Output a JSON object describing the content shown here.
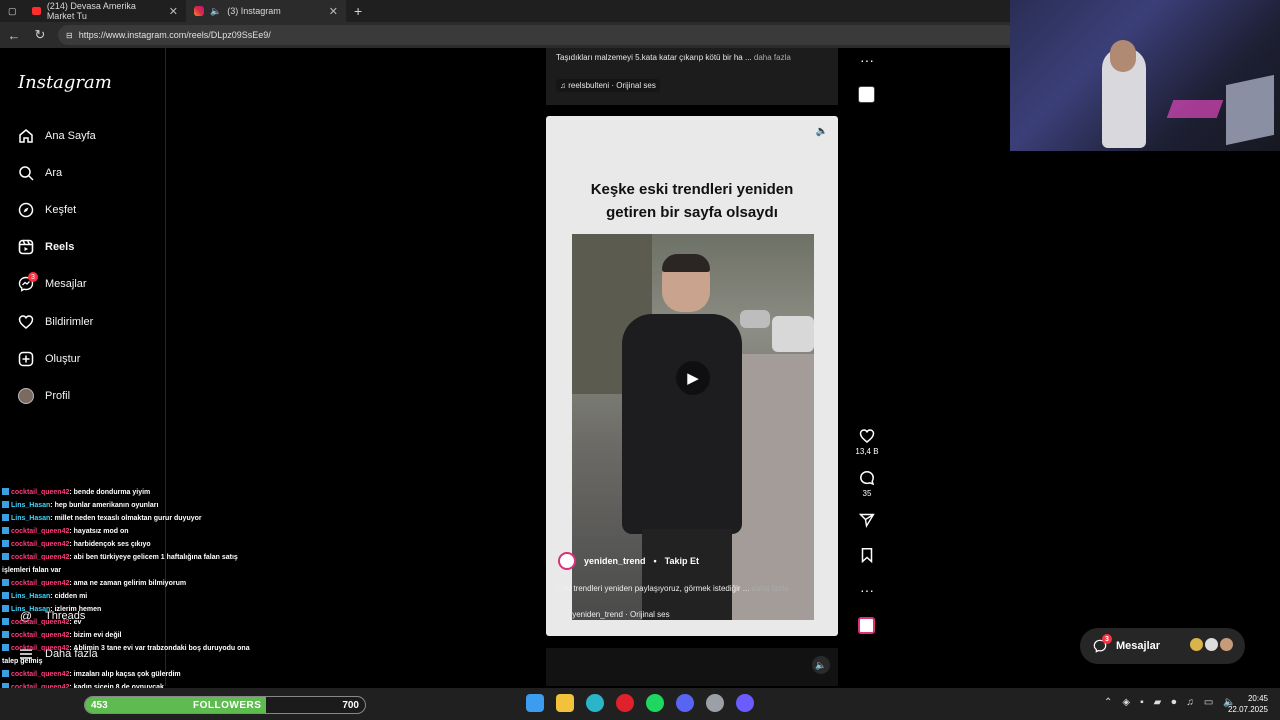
{
  "browser": {
    "tabs": [
      {
        "label": "(214) Devasa Amerika Market Tu",
        "active": false
      },
      {
        "label": "(3) Instagram",
        "active": true
      }
    ],
    "new_tab": "+",
    "url": "https://www.instagram.com/reels/DLpz09SsEe9/"
  },
  "instagram": {
    "logo": "Instagram",
    "nav": [
      {
        "label": "Ana Sayfa",
        "icon": "home-icon"
      },
      {
        "label": "Ara",
        "icon": "search-icon"
      },
      {
        "label": "Keşfet",
        "icon": "compass-icon"
      },
      {
        "label": "Reels",
        "icon": "reels-icon",
        "active": true
      },
      {
        "label": "Mesajlar",
        "icon": "messenger-icon",
        "badge": "3"
      },
      {
        "label": "Bildirimler",
        "icon": "heart-icon"
      },
      {
        "label": "Oluştur",
        "icon": "plus-square-icon"
      },
      {
        "label": "Profil",
        "icon": "avatar"
      }
    ],
    "nav_bottom": [
      {
        "label": "Threads",
        "icon": "threads-icon"
      },
      {
        "label": "Daha fazla",
        "icon": "menu-icon"
      }
    ]
  },
  "reels": {
    "previous": {
      "caption": "Taşıdıkları malzemeyi 5.kata katar çıkarıp kötü bir ha ...",
      "more": "daha fazla",
      "audio": "reelsbulteni · Orijinal ses"
    },
    "current": {
      "headline_line1": "Keşke eski trendleri yeniden",
      "headline_line2": "getiren bir sayfa olsaydı",
      "username": "yeniden_trend",
      "separator": "•",
      "follow": "Takip Et",
      "caption": "Eski trendleri yeniden paylaşıyoruz, görmek istediğir ...",
      "more": "daha fazla",
      "audio": "yeniden_trend · Orijinal ses",
      "likes": "13,4 B",
      "comments": "35"
    }
  },
  "chat": [
    {
      "user": "cocktail_queen42",
      "color": "u1",
      "text": ": bende dondurma yiyim"
    },
    {
      "user": "Lins_Hasan",
      "color": "u2",
      "text": ": hep bunlar amerikanın oyunları"
    },
    {
      "user": "Lins_Hasan",
      "color": "u2",
      "text": ": millet neden texaslı olmaktan gurur duyuyor"
    },
    {
      "user": "cocktail_queen42",
      "color": "u1",
      "text": ": hayatsız mod on"
    },
    {
      "user": "cocktail_queen42",
      "color": "u1",
      "text": ": harbidençok ses çıkıyo"
    },
    {
      "user": "cocktail_queen42",
      "color": "u1",
      "text": ": abi ben türkiyeye gelicem 1 haftalığına falan satış"
    },
    {
      "user": "",
      "color": "u1",
      "text": "işlemleri falan var"
    },
    {
      "user": "cocktail_queen42",
      "color": "u1",
      "text": ": ama ne zaman gelirim bilmiyorum"
    },
    {
      "user": "Lins_Hasan",
      "color": "u2",
      "text": ": cidden mi"
    },
    {
      "user": "Lins_Hasan",
      "color": "u2",
      "text": ": izlerim hemen"
    },
    {
      "user": "cocktail_queen42",
      "color": "u1",
      "text": ": ev"
    },
    {
      "user": "cocktail_queen42",
      "color": "u1",
      "text": ": bizim evi değil"
    },
    {
      "user": "cocktail_queen42",
      "color": "u1",
      "text": ": Ablimin 3 tane evi var trabzondaki boş duruyodu ona"
    },
    {
      "user": "",
      "color": "u1",
      "text": "talep gelmiş"
    },
    {
      "user": "cocktail_queen42",
      "color": "u1",
      "text": ": imzaları alıp kaçsa çok gülerdim"
    },
    {
      "user": "cocktail_queen42",
      "color": "u1",
      "text": ": kadın sicein 8 de oynuycak"
    }
  ],
  "messages_pill": {
    "label": "Mesajlar",
    "badge": "3"
  },
  "followers": {
    "current": "453",
    "label": "FOLLOWERS",
    "goal": "700",
    "progress": 0.647
  },
  "taskbar": {
    "apps": [
      "windows-start-icon",
      "file-explorer-icon",
      "edge-icon",
      "opera-icon",
      "spotify-icon",
      "discord-icon",
      "steam-icon",
      "obs-icon"
    ],
    "time": "20:45",
    "date": "22.07.2025"
  },
  "colors": {
    "instagram_gradient": "#dc2743",
    "chat_user_pink": "#ff3b7a",
    "chat_user_cyan": "#3fd6ff",
    "followers_fill": "#5dbb4f",
    "accent_red": "#ff3040"
  }
}
